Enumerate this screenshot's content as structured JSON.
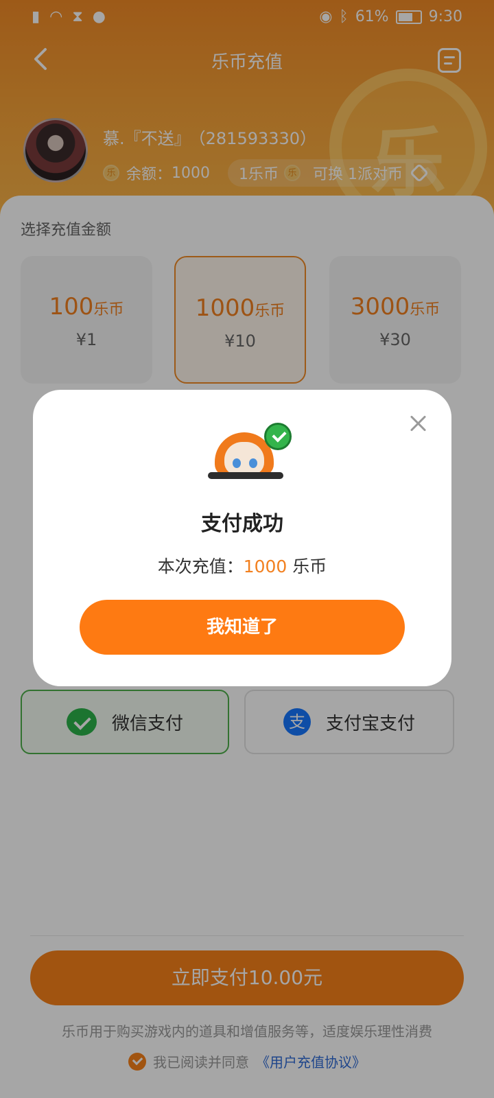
{
  "status_bar": {
    "battery": "61%",
    "time": "9:30"
  },
  "nav": {
    "title": "乐币充值"
  },
  "user": {
    "name": "慕.『不送』",
    "id": "（281593330）",
    "balance_label": "余额：",
    "balance_value": "1000",
    "rate_left": "1乐币",
    "rate_right": "可换 1派对币"
  },
  "recharge": {
    "section_label": "选择充值金额",
    "unit": "乐币",
    "options": [
      {
        "amount": "100",
        "price": "¥1"
      },
      {
        "amount": "1000",
        "price": "¥10"
      },
      {
        "amount": "3000",
        "price": "¥30"
      }
    ],
    "selected_index": 1
  },
  "payment": {
    "wechat_label": "微信支付",
    "alipay_label": "支付宝支付",
    "alipay_glyph": "支"
  },
  "footer": {
    "pay_button": "立即支付10.00元",
    "notice": "乐币用于购买游戏内的道具和增值服务等，适度娱乐理性消费",
    "agree_text": "我已阅读并同意",
    "agree_link": "《用户充值协议》"
  },
  "modal": {
    "title": "支付成功",
    "msg_prefix": "本次充值：",
    "msg_amount": "1000",
    "msg_suffix": " 乐币",
    "button": "我知道了"
  },
  "colors": {
    "brand_orange": "#f7821a",
    "header_orange": "#f28b26",
    "wechat_green": "#2bb34a",
    "alipay_blue": "#1677ff",
    "success_green": "#33b44b"
  },
  "icons": [
    "signal-icon",
    "wifi-icon",
    "hourglass-icon",
    "wechat-notification-icon",
    "eye-icon",
    "bluetooth-icon",
    "battery-icon",
    "back-arrow-icon",
    "records-icon",
    "coin-icon",
    "party-coin-icon",
    "close-icon",
    "success-check-icon",
    "wechat-icon",
    "alipay-icon",
    "checkbox-icon"
  ]
}
